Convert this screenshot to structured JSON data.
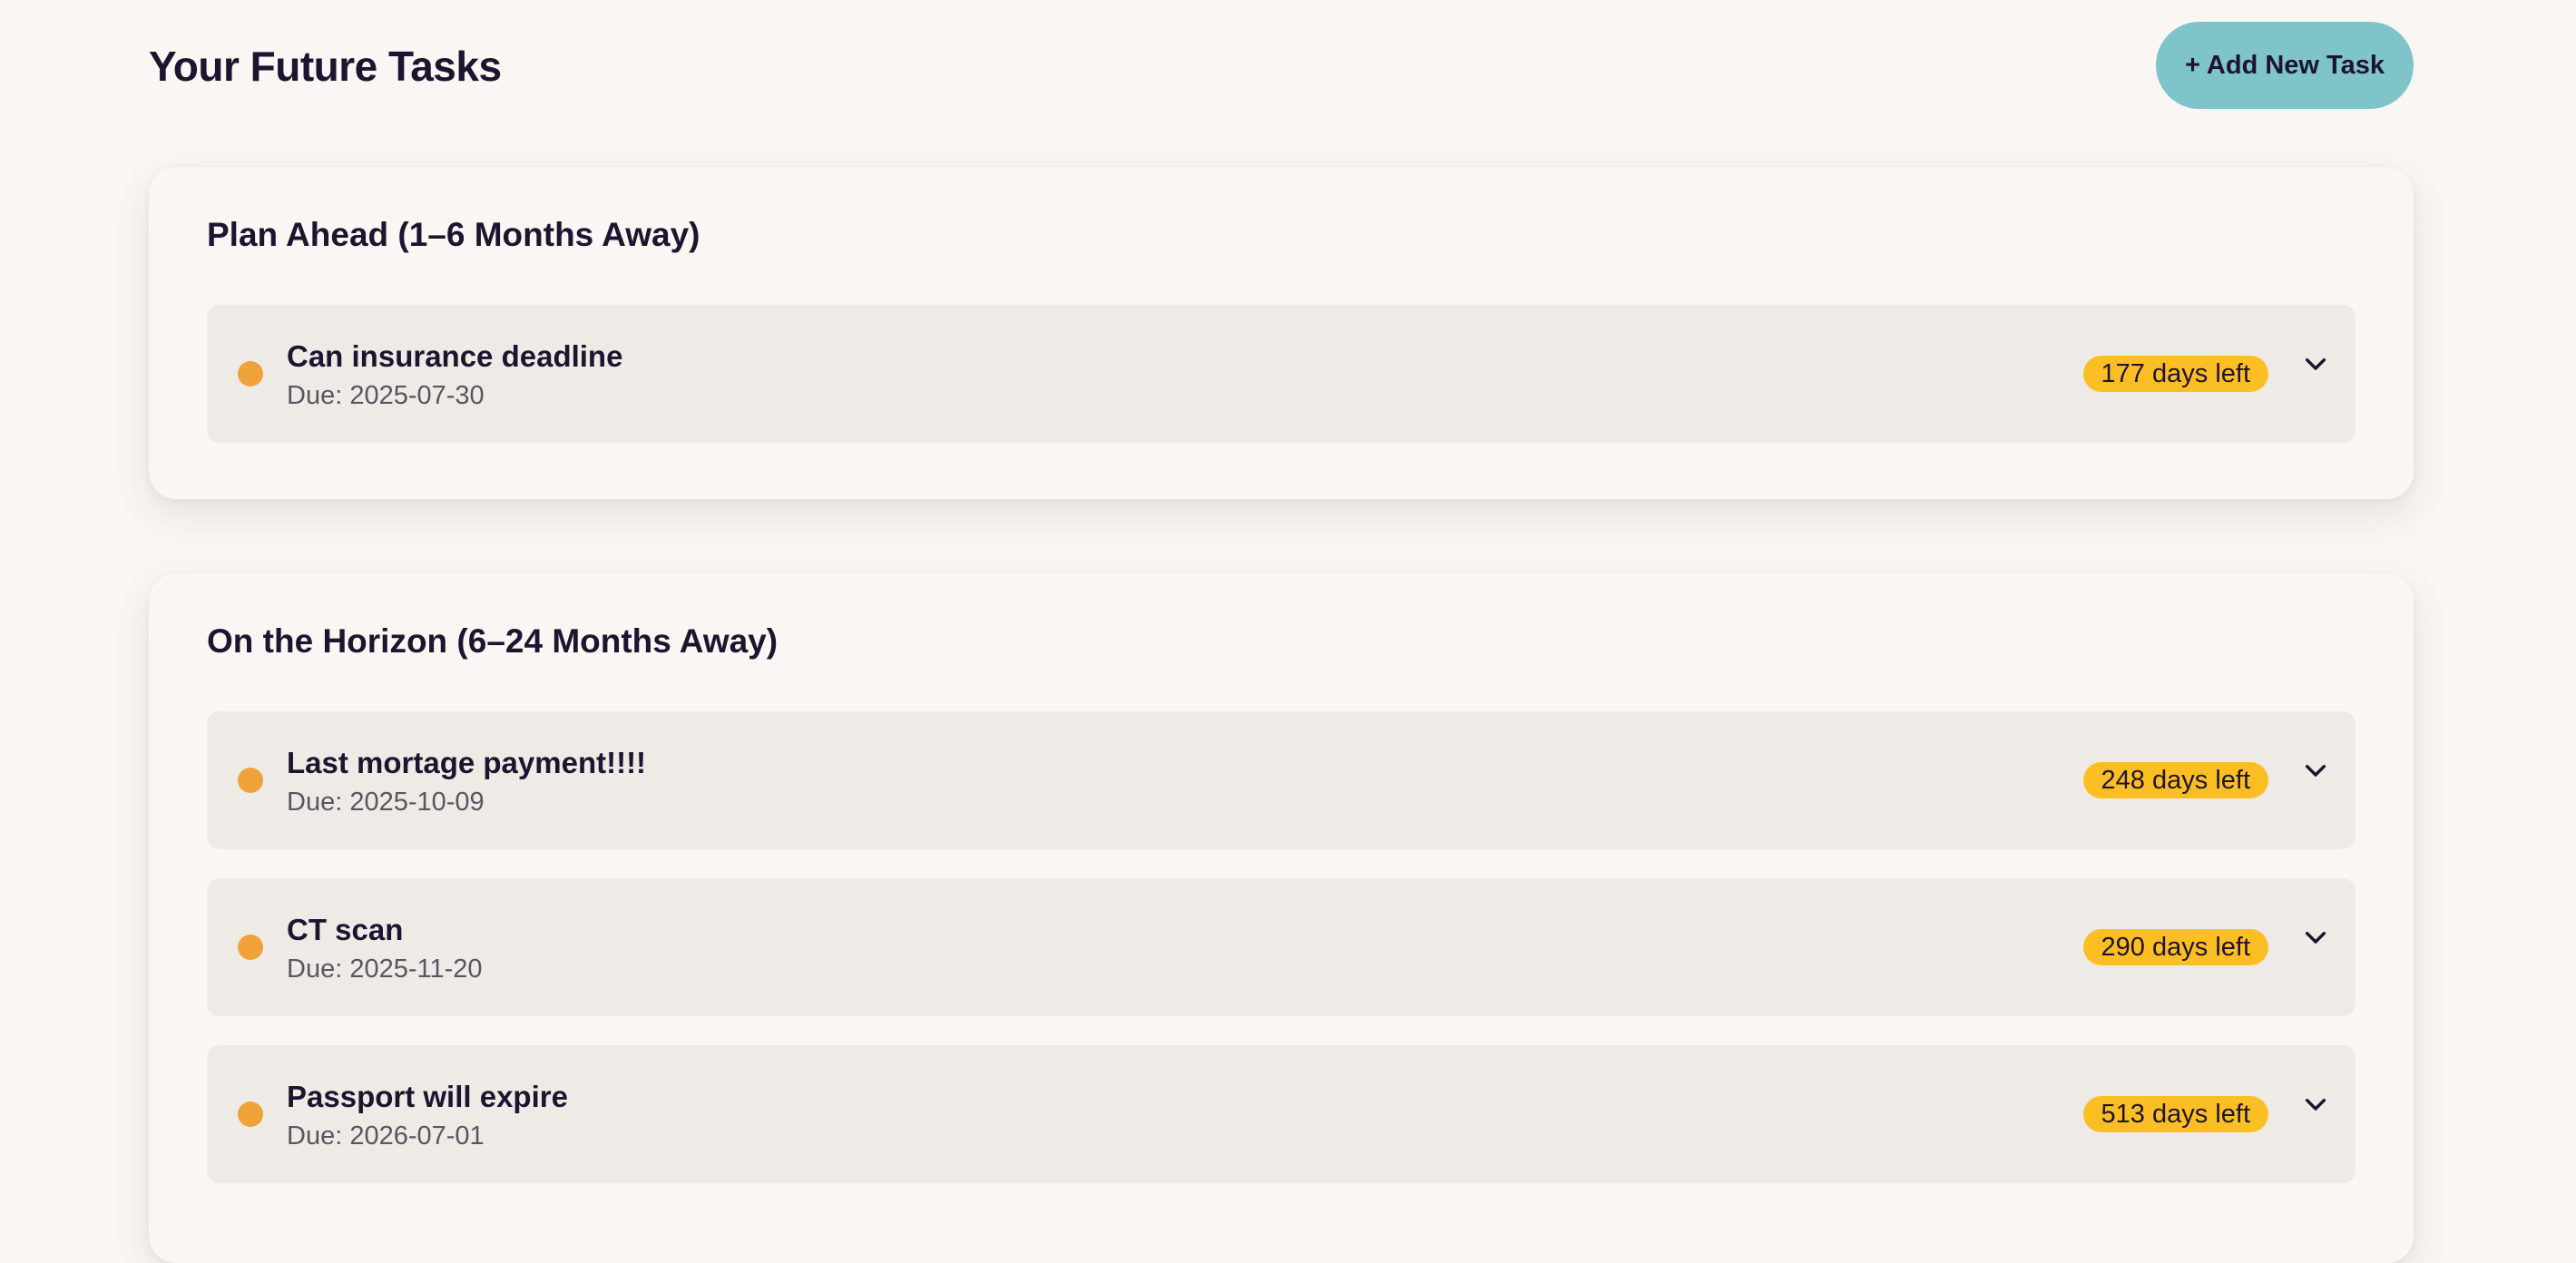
{
  "header": {
    "title": "Your Future Tasks",
    "add_button_label": "+ Add New Task"
  },
  "colors": {
    "background": "#faf6f3",
    "accent_button": "#7ec4c9",
    "task_row": "#eeeae6",
    "status_dot": "#f0a23a",
    "days_badge": "#fbbf24",
    "text_primary": "#1f1430"
  },
  "sections": [
    {
      "title": "Plan Ahead (1–6 Months Away)",
      "tasks": [
        {
          "title": "Can insurance deadline",
          "due_prefix": "Due: ",
          "due_date": "2025-07-30",
          "days": "177",
          "days_unit": "days",
          "days_suffix": "left",
          "icon": "chevron-down-icon"
        }
      ]
    },
    {
      "title": "On the Horizon (6–24 Months Away)",
      "tasks": [
        {
          "title": "Last mortage payment!!!!",
          "due_prefix": "Due: ",
          "due_date": "2025-10-09",
          "days": "248",
          "days_unit": "days",
          "days_suffix": "left",
          "icon": "chevron-down-icon"
        },
        {
          "title": "CT scan",
          "due_prefix": "Due: ",
          "due_date": "2025-11-20",
          "days": "290",
          "days_unit": "days",
          "days_suffix": "left",
          "icon": "chevron-down-icon"
        },
        {
          "title": "Passport will expire",
          "due_prefix": "Due: ",
          "due_date": "2026-07-01",
          "days": "513",
          "days_unit": "days",
          "days_suffix": "left",
          "icon": "chevron-down-icon"
        }
      ]
    }
  ]
}
